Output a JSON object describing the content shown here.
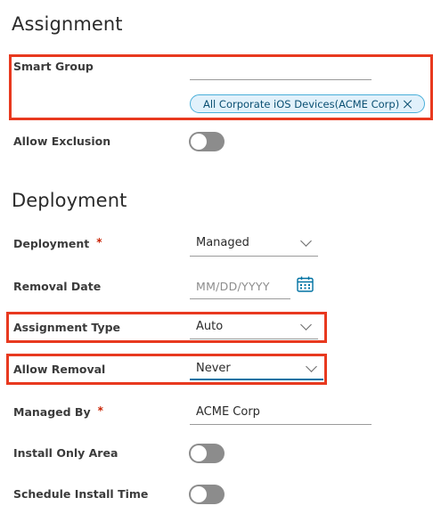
{
  "assignment": {
    "title": "Assignment",
    "smart_group": {
      "label": "Smart Group",
      "input_value": "",
      "chip_label": "All Corporate iOS Devices(ACME Corp)"
    },
    "allow_exclusion": {
      "label": "Allow Exclusion",
      "enabled": false
    }
  },
  "deployment": {
    "title": "Deployment",
    "deployment": {
      "label": "Deployment",
      "required_marker": "*",
      "value": "Managed"
    },
    "removal_date": {
      "label": "Removal Date",
      "placeholder": "MM/DD/YYYY",
      "icon": "calendar-icon"
    },
    "assignment_type": {
      "label": "Assignment Type",
      "value": "Auto"
    },
    "allow_removal": {
      "label": "Allow Removal",
      "value": "Never"
    },
    "managed_by": {
      "label": "Managed By",
      "required_marker": "*",
      "value": "ACME Corp"
    },
    "install_only_area": {
      "label": "Install Only Area",
      "enabled": false
    },
    "schedule_install_time": {
      "label": "Schedule Install Time",
      "enabled": false
    }
  },
  "colors": {
    "highlight": "#e8391f",
    "chip_background": "#e1f1fb",
    "chip_border": "#49afd9",
    "accent": "#0072a3",
    "required": "#c92100",
    "toggle_off": "#8c8c8c"
  }
}
